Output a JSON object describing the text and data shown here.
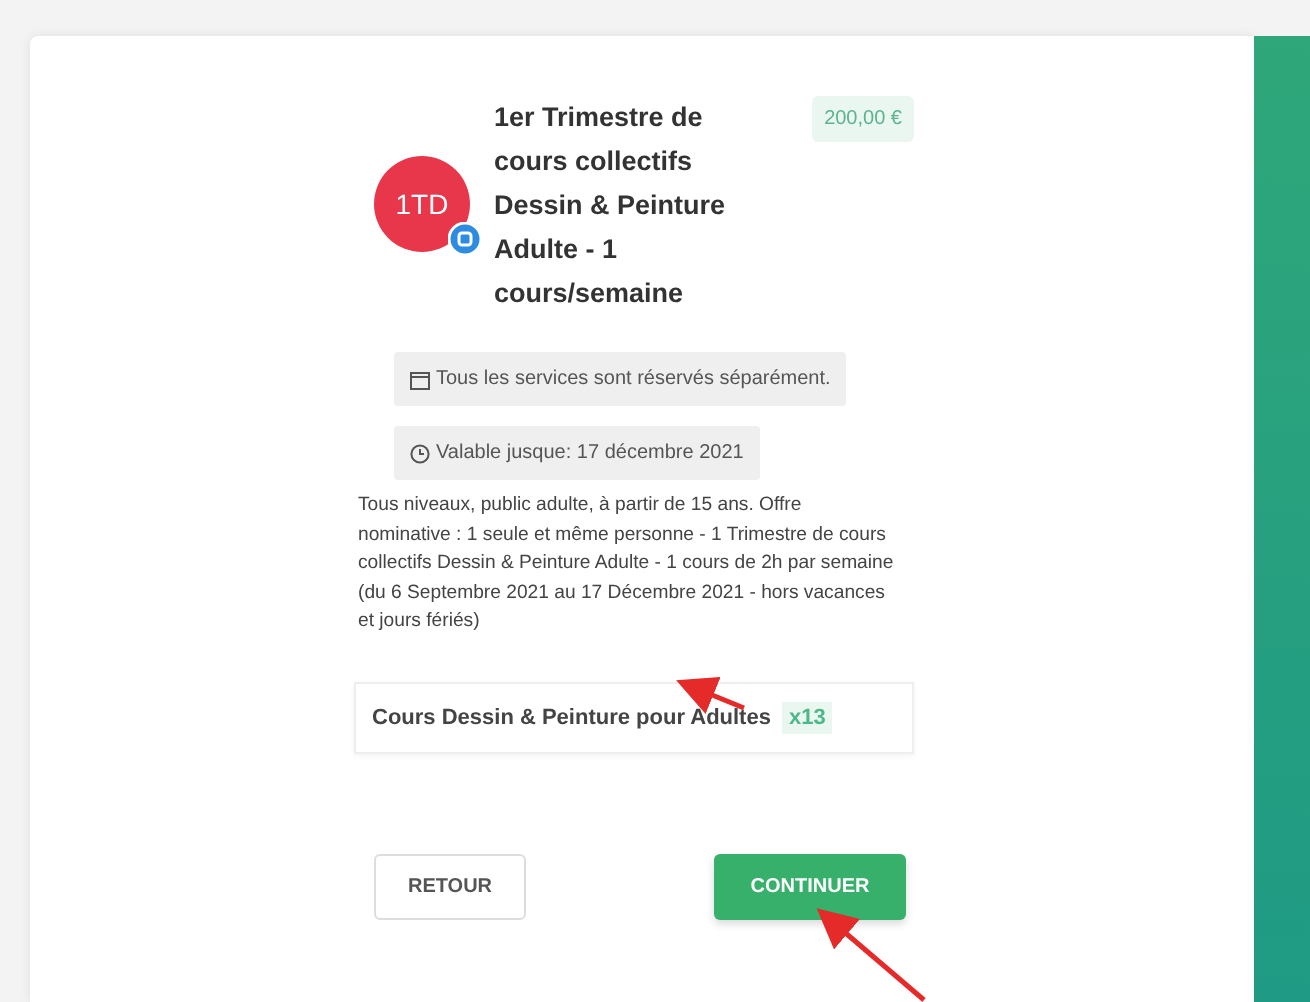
{
  "offer": {
    "avatar": "1TD",
    "title": "1er Trimestre de cours collectifs Dessin & Peinture Adulte - 1 cours/semaine",
    "price": "200,00 €",
    "notes": [
      {
        "kind": "calendar",
        "text": "Tous les services sont réservés séparément."
      },
      {
        "kind": "clock",
        "text": "Valable jusque: 17 décembre 2021"
      }
    ],
    "description": "Tous niveaux, public adulte, à partir de 15 ans. Offre nominative : 1 seule et même personne - 1 Trimestre de cours collectifs Dessin & Peinture Adulte - 1 cours de 2h par semaine (du 6 Septembre 2021 au 17 Décembre 2021 - hors vacances et jours fériés)",
    "service": {
      "name": "Cours Dessin & Peinture pour Adultes",
      "count": "x13"
    }
  },
  "buttons": [
    {
      "kind": "secondary",
      "label": "RETOUR"
    },
    {
      "kind": "primary",
      "label": "CONTINUER"
    }
  ]
}
